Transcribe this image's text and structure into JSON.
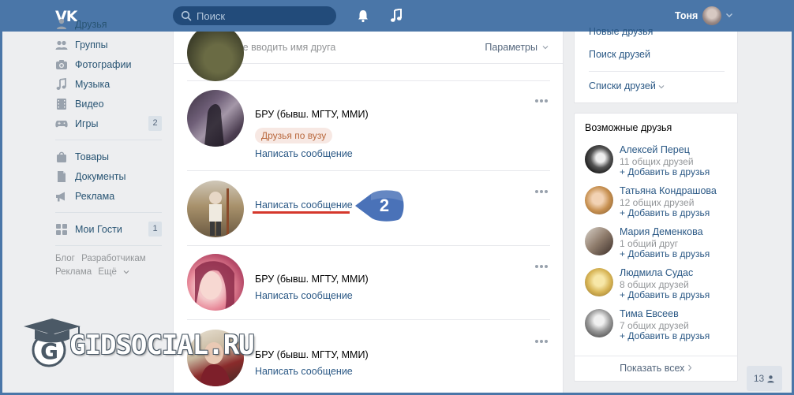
{
  "header": {
    "search_placeholder": "Поиск",
    "user_name": "Тоня"
  },
  "sidebar": {
    "items": [
      {
        "label": "Друзья",
        "icon": "user-icon"
      },
      {
        "label": "Группы",
        "icon": "group-icon"
      },
      {
        "label": "Фотографии",
        "icon": "camera-icon"
      },
      {
        "label": "Музыка",
        "icon": "music-icon"
      },
      {
        "label": "Видео",
        "icon": "video-icon"
      },
      {
        "label": "Игры",
        "icon": "gamepad-icon",
        "count": "2"
      },
      {
        "label": "Товары",
        "icon": "bag-icon"
      },
      {
        "label": "Документы",
        "icon": "document-icon"
      },
      {
        "label": "Реклама",
        "icon": "megaphone-icon"
      },
      {
        "label": "Мои Гости",
        "icon": "apps-icon",
        "count": "1"
      }
    ],
    "footer_links": [
      "Блог",
      "Разработчикам",
      "Реклама",
      "Ещё"
    ]
  },
  "main": {
    "search_placeholder": "Начните вводить имя друга",
    "params_label": "Параметры",
    "friends": [
      {
        "subtitle": "БРУ (бывш. МГТУ, ММИ)",
        "tag": "Друзья по вузу",
        "action": "Написать сообщение"
      },
      {
        "subtitle": "",
        "action": "Написать сообщение"
      },
      {
        "subtitle": "БРУ (бывш. МГТУ, ММИ)",
        "action": "Написать сообщение"
      },
      {
        "subtitle": "БРУ (бывш. МГТУ, ММИ)",
        "action": "Написать сообщение"
      }
    ]
  },
  "annotation": {
    "number": "2",
    "color": "#4a72b8",
    "underline_color": "#d5382c"
  },
  "right": {
    "links": [
      "Новые друзья",
      "Поиск друзей",
      "Списки друзей"
    ],
    "possible_title": "Возможные друзья",
    "possible": [
      {
        "name": "Алексей Перец",
        "common": "11 общих друзей",
        "add": "Добавить в друзья"
      },
      {
        "name": "Татьяна Кондрашова",
        "common": "12 общих друзей",
        "add": "Добавить в друзья"
      },
      {
        "name": "Мария Деменкова",
        "common": "1 общий друг",
        "add": "Добавить в друзья"
      },
      {
        "name": "Людмила Судас",
        "common": "8 общих друзей",
        "add": "Добавить в друзья"
      },
      {
        "name": "Тима Евсеев",
        "common": "7 общих друзей",
        "add": "Добавить в друзья"
      }
    ],
    "show_all": "Показать всех"
  },
  "corner_badge": "13",
  "watermark": "GIDSOCIAL.RU",
  "colors": {
    "brand": "#4a76a8",
    "link": "#2a5885",
    "background": "#edeef0"
  }
}
